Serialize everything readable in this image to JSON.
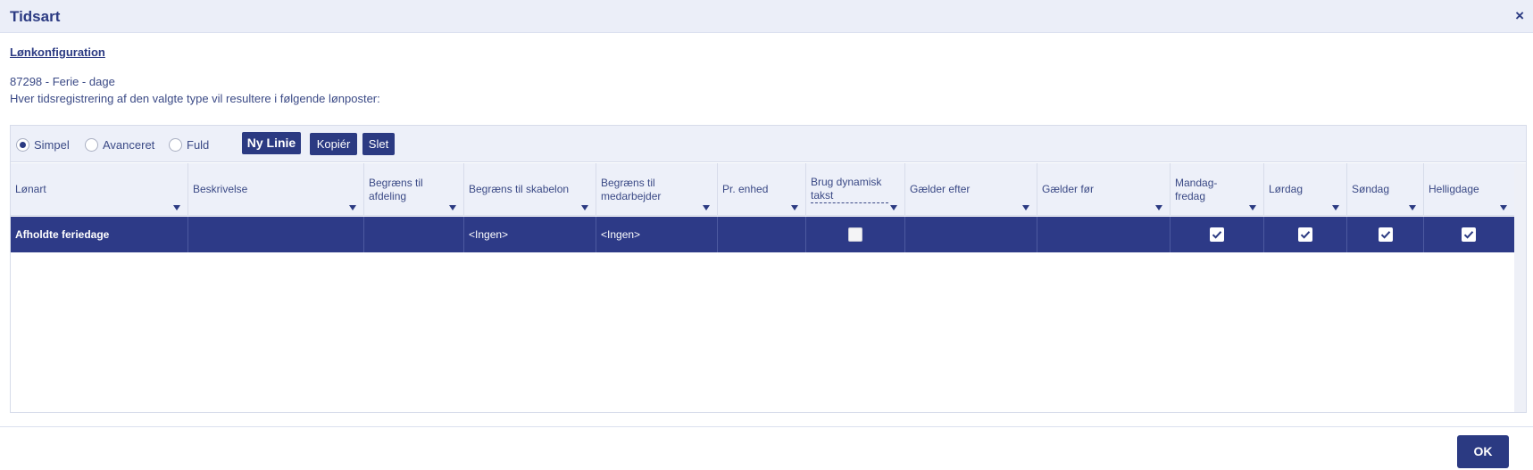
{
  "window": {
    "title": "Tidsart",
    "close_glyph": "×"
  },
  "section": {
    "heading": "Lønkonfiguration",
    "item_line": "87298 - Ferie - dage",
    "description": "Hver tidsregistrering af den valgte type vil resultere i følgende lønposter:"
  },
  "toolbar": {
    "modes": [
      {
        "label": "Simpel",
        "selected": true
      },
      {
        "label": "Avanceret",
        "selected": false
      },
      {
        "label": "Fuld",
        "selected": false
      }
    ],
    "new_line_label": "Ny Linie",
    "copy_label": "Kopiér",
    "delete_label": "Slet"
  },
  "table": {
    "columns": [
      {
        "key": "lonart",
        "label": "Lønart"
      },
      {
        "key": "beskrivelse",
        "label": "Beskrivelse"
      },
      {
        "key": "afdeling",
        "label": "Begræns til afdeling"
      },
      {
        "key": "skabelon",
        "label": "Begræns til skabelon"
      },
      {
        "key": "medarbejder",
        "label": "Begræns til medarbejder"
      },
      {
        "key": "enhed",
        "label": "Pr. enhed"
      },
      {
        "key": "dynamisk",
        "label": "Brug dynamisk takst"
      },
      {
        "key": "efter",
        "label": "Gælder efter"
      },
      {
        "key": "for",
        "label": "Gælder før"
      },
      {
        "key": "mandag",
        "label": "Mandag-fredag"
      },
      {
        "key": "lordag",
        "label": "Lørdag"
      },
      {
        "key": "sondag",
        "label": "Søndag"
      },
      {
        "key": "helligdage",
        "label": "Helligdage"
      }
    ],
    "rows": [
      {
        "lonart": "Afholdte feriedage",
        "beskrivelse": "",
        "afdeling": "",
        "skabelon": "<Ingen>",
        "medarbejder": "<Ingen>",
        "enhed": "",
        "dynamisk": false,
        "efter": "",
        "for": "",
        "mandag": true,
        "lordag": true,
        "sondag": true,
        "helligdage": true
      }
    ]
  },
  "footer": {
    "ok_label": "OK"
  },
  "colors": {
    "accent": "#2b3a82",
    "header_bg": "#edf0f9",
    "selected_row": "#2d3a87"
  }
}
